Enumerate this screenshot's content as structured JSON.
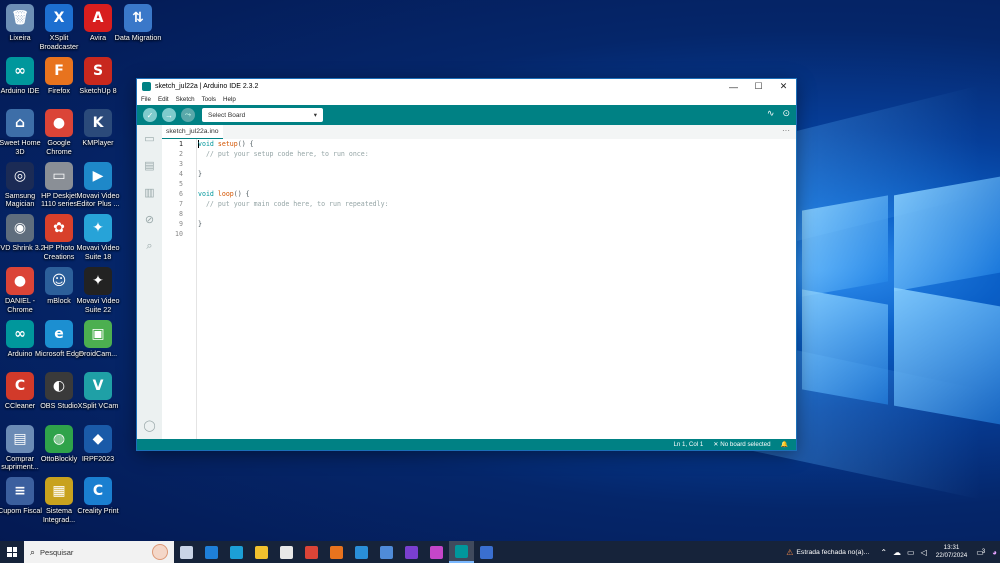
{
  "desktop": {
    "icons": [
      {
        "label": "Lixeira",
        "color": "#6d8fb5",
        "glyph": "🗑"
      },
      {
        "label": "XSplit Broadcaster",
        "color": "#1d6fd0",
        "glyph": "X"
      },
      {
        "label": "Avira",
        "color": "#d81e1e",
        "glyph": "A"
      },
      {
        "label": "Data Migration",
        "color": "#3a78c9",
        "glyph": "⇅"
      },
      {
        "label": "Arduino IDE",
        "color": "#00979c",
        "glyph": "∞"
      },
      {
        "label": "Firefox",
        "color": "#e8731e",
        "glyph": "F"
      },
      {
        "label": "SketchUp 8",
        "color": "#c8281e",
        "glyph": "S"
      },
      {
        "label": "Sweet Home 3D",
        "color": "#3d6ea8",
        "glyph": "⌂"
      },
      {
        "label": "Google Chrome",
        "color": "#db4437",
        "glyph": "●"
      },
      {
        "label": "KMPlayer",
        "color": "#2b4a7a",
        "glyph": "K"
      },
      {
        "label": "Samsung Magician",
        "color": "#1b2b55",
        "glyph": "◎"
      },
      {
        "label": "HP Deskjet 1110 series",
        "color": "#8a8f96",
        "glyph": "▭"
      },
      {
        "label": "Movavi Video Editor Plus ...",
        "color": "#1e88c9",
        "glyph": "▶"
      },
      {
        "label": "DVD Shrink 3.2",
        "color": "#5f6d7d",
        "glyph": "◉"
      },
      {
        "label": "HP Photo Creations",
        "color": "#d8402b",
        "glyph": "✿"
      },
      {
        "label": "Movavi Video Suite 18",
        "color": "#27a3d8",
        "glyph": "✦"
      },
      {
        "label": "DANIEL - Chrome",
        "color": "#db4437",
        "glyph": "●"
      },
      {
        "label": "mBlock",
        "color": "#2c5f9a",
        "glyph": "☺"
      },
      {
        "label": "Movavi Video Suite 22",
        "color": "#222",
        "glyph": "✦"
      },
      {
        "label": "Arduino",
        "color": "#00979c",
        "glyph": "∞"
      },
      {
        "label": "Microsoft Edge",
        "color": "#1c8fd1",
        "glyph": "e"
      },
      {
        "label": "DroidCam...",
        "color": "#4caf50",
        "glyph": "▣"
      },
      {
        "label": "CCleaner",
        "color": "#d23a2a",
        "glyph": "C"
      },
      {
        "label": "OBS Studio",
        "color": "#3a3a3a",
        "glyph": "◐"
      },
      {
        "label": "XSplit VCam",
        "color": "#1fa0a6",
        "glyph": "V"
      },
      {
        "label": "Comprar supriment...",
        "color": "#6b8bb5",
        "glyph": "▤"
      },
      {
        "label": "OttoBlockly",
        "color": "#2fa34a",
        "glyph": "◍"
      },
      {
        "label": "IRPF2023",
        "color": "#1a5aa8",
        "glyph": "◆"
      },
      {
        "label": "Cupom Fiscal",
        "color": "#3b5f9e",
        "glyph": "≡"
      },
      {
        "label": "Sistema Integrad...",
        "color": "#c8a21e",
        "glyph": "▦"
      },
      {
        "label": "Creality Print",
        "color": "#1a7fd0",
        "glyph": "C"
      }
    ]
  },
  "window": {
    "title": "sketch_jul22a | Arduino IDE 2.3.2",
    "controls": {
      "minimize": "—",
      "maximize": "☐",
      "close": "✕"
    },
    "menu": [
      "File",
      "Edit",
      "Sketch",
      "Tools",
      "Help"
    ],
    "toolbar": {
      "verify": "✓",
      "upload": "→",
      "debug": "⤳",
      "board_select": "Select Board",
      "board_chevron": "▾",
      "serial_plotter": "∿",
      "serial_monitor": "⊙"
    },
    "sidebar": [
      "▭",
      "▤",
      "▥",
      "⊘",
      "⌕"
    ],
    "sidebar_profile": "◯",
    "tab": {
      "label": "sketch_jul22a.ino",
      "more": "···"
    },
    "editor": {
      "line_numbers": [
        "1",
        "2",
        "3",
        "4",
        "5",
        "6",
        "7",
        "8",
        "9",
        "10"
      ],
      "lines": [
        {
          "kw": "void",
          "fn": "setup",
          "rest": "() {",
          "cm": ""
        },
        {
          "kw": "",
          "fn": "",
          "rest": "  ",
          "cm": "// put your setup code here, to run once:"
        },
        {
          "kw": "",
          "fn": "",
          "rest": "",
          "cm": ""
        },
        {
          "kw": "",
          "fn": "",
          "rest": "}",
          "cm": ""
        },
        {
          "kw": "",
          "fn": "",
          "rest": "",
          "cm": ""
        },
        {
          "kw": "void",
          "fn": "loop",
          "rest": "() {",
          "cm": ""
        },
        {
          "kw": "",
          "fn": "",
          "rest": "  ",
          "cm": "// put your main code here, to run repeatedly:"
        },
        {
          "kw": "",
          "fn": "",
          "rest": "",
          "cm": ""
        },
        {
          "kw": "",
          "fn": "",
          "rest": "}",
          "cm": ""
        },
        {
          "kw": "",
          "fn": "",
          "rest": "",
          "cm": ""
        }
      ]
    },
    "status": {
      "position": "Ln 1, Col 1",
      "board": "✕ No board selected",
      "bell": "🔔"
    }
  },
  "taskbar": {
    "search_placeholder": "Pesquisar",
    "apps": [
      {
        "name": "task-view",
        "color": "#c9d4e6"
      },
      {
        "name": "mail",
        "color": "#1e7fd8"
      },
      {
        "name": "edge",
        "color": "#1c9fd6"
      },
      {
        "name": "explorer",
        "color": "#f2c12e"
      },
      {
        "name": "store",
        "color": "#e8e8e8"
      },
      {
        "name": "chrome",
        "color": "#db4437"
      },
      {
        "name": "firefox",
        "color": "#e8731e"
      },
      {
        "name": "creality",
        "color": "#2a8fd8"
      },
      {
        "name": "creality-2",
        "color": "#4f8bd8"
      },
      {
        "name": "app-purple",
        "color": "#7a3fd0"
      },
      {
        "name": "movavi",
        "color": "#c546c9"
      },
      {
        "name": "arduino",
        "color": "#00979c"
      },
      {
        "name": "app-blue",
        "color": "#3a6fd0"
      }
    ],
    "tray": {
      "network_status": "Estrada fechada no(a)...",
      "time": "13:31",
      "date": "22/07/2024",
      "notification_count": "3"
    }
  }
}
